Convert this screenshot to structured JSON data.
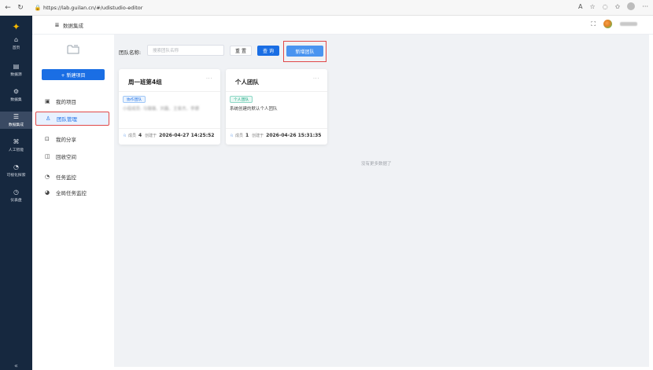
{
  "browser": {
    "url": "https://lab.guilan.cn/#/udistudio-editor"
  },
  "rail": {
    "items": [
      {
        "label": "首页",
        "icon": "home-icon"
      },
      {
        "label": "数据源",
        "icon": "database-icon"
      },
      {
        "label": "数据集",
        "icon": "dataset-icon"
      },
      {
        "label": "数据集成",
        "icon": "integration-icon",
        "active": true
      },
      {
        "label": "人工智能",
        "icon": "ai-icon"
      },
      {
        "label": "可视化探索",
        "icon": "visual-icon"
      },
      {
        "label": "仪表盘",
        "icon": "dashboard-icon"
      }
    ],
    "collapse_symbol": "«"
  },
  "header": {
    "title": "数据集成"
  },
  "sidebar": {
    "new_project_label": "+ 新建项目",
    "items": [
      {
        "label": "我的项目",
        "icon": "project-icon"
      },
      {
        "label": "团队管理",
        "icon": "team-icon",
        "active": true
      },
      {
        "label": "我的分享",
        "icon": "share-icon"
      },
      {
        "label": "回收空间",
        "icon": "recycle-icon"
      },
      {
        "label": "任务监控",
        "icon": "monitor-icon"
      },
      {
        "label": "全局任务监控",
        "icon": "global-monitor-icon"
      }
    ]
  },
  "filter": {
    "label": "团队名称:",
    "placeholder": "搜索团队名称",
    "reset_label": "重 置",
    "query_label": "查 询",
    "new_team_label": "新增团队"
  },
  "cards": [
    {
      "title": "周一班第4组",
      "tag": "协作团队",
      "desc": "小组成员: 马璐璐、刘磊、王俊杰、李娜",
      "desc_blurred": true,
      "members_label": "成员",
      "members": "4",
      "created_label": "创建于",
      "created": "2026-04-27 14:25:52"
    },
    {
      "title": "个人团队",
      "tag": "个人团队",
      "desc": "系统创建的默认个人团队",
      "desc_blurred": false,
      "members_label": "成员",
      "members": "1",
      "created_label": "创建于",
      "created": "2026-04-26 15:31:35"
    }
  ],
  "empty_note": "没有更多数据了",
  "colors": {
    "rail_bg": "#16283f",
    "primary": "#1a6ee4",
    "highlight_border": "#e04848",
    "main_bg": "#f0f2f5"
  }
}
